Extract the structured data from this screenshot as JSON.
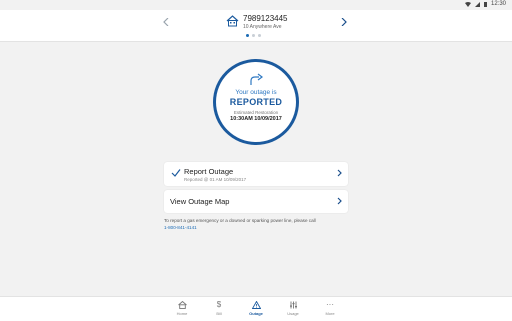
{
  "status_bar": {
    "time": "12:30",
    "icons": [
      "wifi-icon",
      "signal-icon",
      "battery-icon"
    ]
  },
  "account": {
    "number": "7989123445",
    "address": "10 Anywhere Ave",
    "icon": "house-icon",
    "page_count": 3,
    "active_page": 1
  },
  "outage_status": {
    "line1": "Your outage is",
    "status": "REPORTED",
    "estimate_label": "Estimated Restoration",
    "estimate_value": "10:30AM 10/09/2017",
    "icon": "plug-icon"
  },
  "report_card": {
    "title": "Report Outage",
    "subtitle": "Reported @ 01 AM 10/09/2017",
    "icon": "checkmark-icon"
  },
  "map_card": {
    "title": "View Outage Map"
  },
  "info": {
    "text": "To report a gas emergency or a downed or sparking power line, please call",
    "phone": "1-800-841-4141"
  },
  "bottom_nav": [
    {
      "label": "Home",
      "icon": "home-icon"
    },
    {
      "label": "Bill",
      "icon": "dollar-icon"
    },
    {
      "label": "Outage",
      "icon": "warning-icon",
      "active": true
    },
    {
      "label": "Usage",
      "icon": "sliders-icon"
    },
    {
      "label": "More",
      "icon": "more-icon"
    }
  ],
  "colors": {
    "accent": "#1b5a9e",
    "link": "#1b6bb5",
    "background": "#f2f2f2"
  }
}
